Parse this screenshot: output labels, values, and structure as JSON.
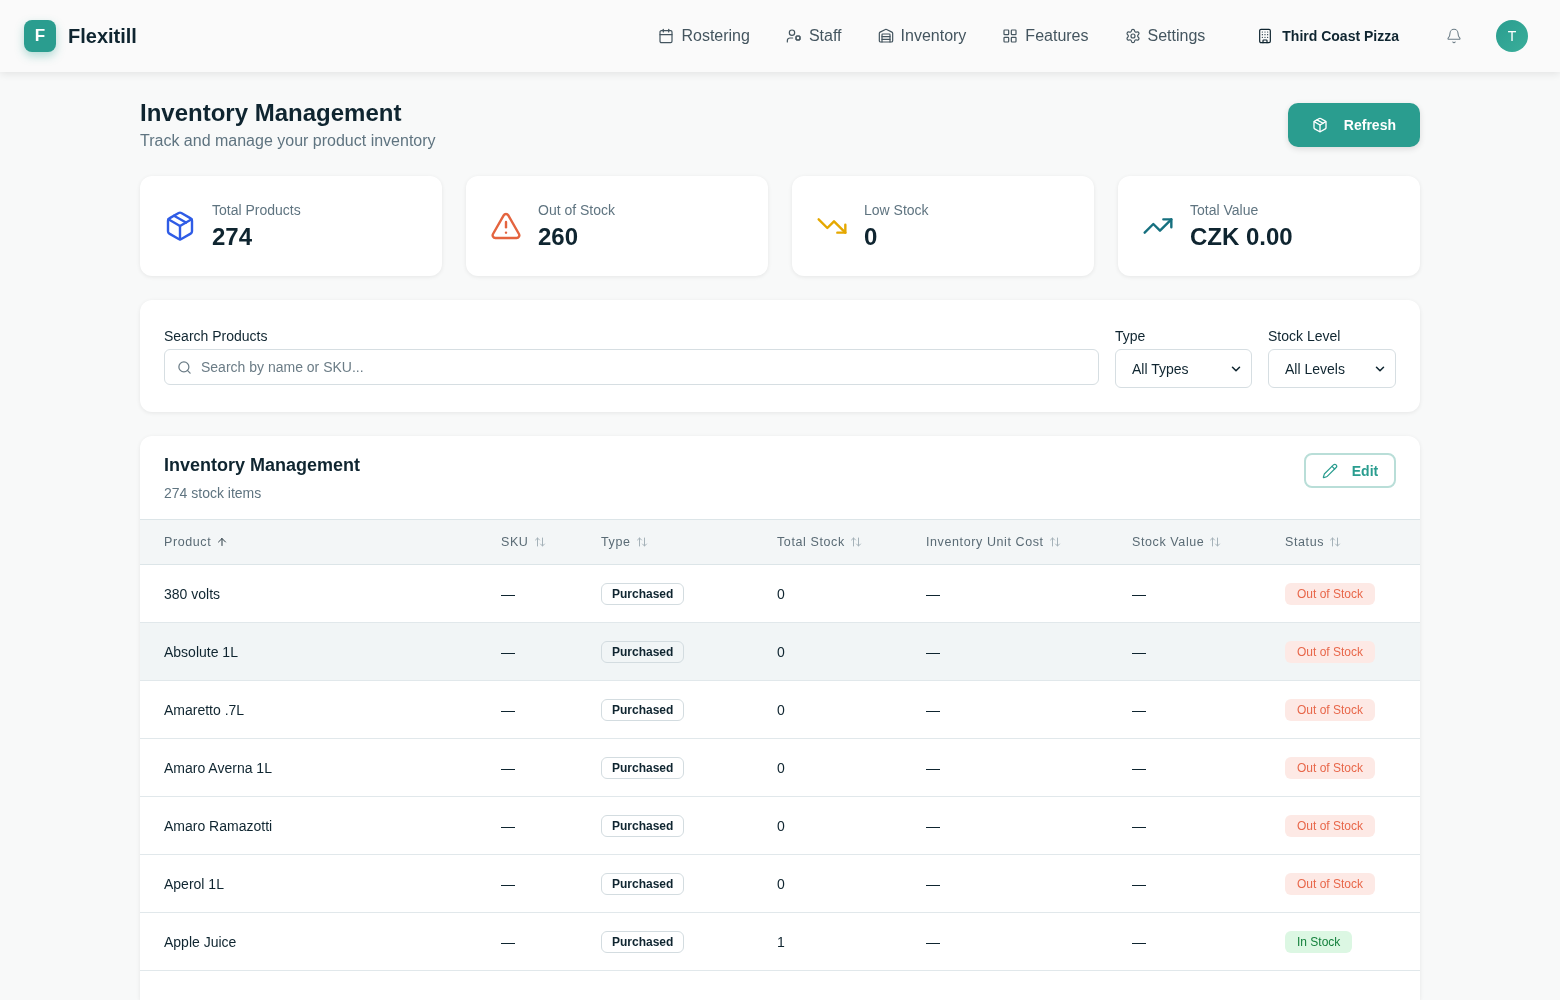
{
  "app": {
    "logo_letter": "F",
    "name": "Flexitill"
  },
  "nav": {
    "items": [
      {
        "label": "Rostering"
      },
      {
        "label": "Staff"
      },
      {
        "label": "Inventory"
      },
      {
        "label": "Features"
      },
      {
        "label": "Settings"
      }
    ]
  },
  "org": {
    "name": "Third Coast Pizza"
  },
  "user": {
    "initial": "T"
  },
  "page": {
    "title": "Inventory Management",
    "subtitle": "Track and manage your product inventory",
    "refresh_label": "Refresh"
  },
  "stats": [
    {
      "label": "Total Products",
      "value": "274"
    },
    {
      "label": "Out of Stock",
      "value": "260"
    },
    {
      "label": "Low Stock",
      "value": "0"
    },
    {
      "label": "Total Value",
      "value": "CZK 0.00"
    }
  ],
  "filters": {
    "search": {
      "label": "Search Products",
      "placeholder": "Search by name or SKU..."
    },
    "type": {
      "label": "Type",
      "value": "All Types"
    },
    "stock_level": {
      "label": "Stock Level",
      "value": "All Levels"
    }
  },
  "table": {
    "title": "Inventory Management",
    "subtitle": "274 stock items",
    "edit_label": "Edit",
    "columns": [
      {
        "label": "Product",
        "sorted": true
      },
      {
        "label": "SKU",
        "sorted": false
      },
      {
        "label": "Type",
        "sorted": false
      },
      {
        "label": "Total Stock",
        "sorted": false
      },
      {
        "label": "Inventory Unit Cost",
        "sorted": false
      },
      {
        "label": "Stock Value",
        "sorted": false
      },
      {
        "label": "Status",
        "sorted": false
      }
    ],
    "rows": [
      {
        "product": "380 volts",
        "sku": "—",
        "type": "Purchased",
        "total_stock": "0",
        "unit_cost": "—",
        "stock_value": "—",
        "status": {
          "label": "Out of Stock",
          "kind": "out_of_stock"
        },
        "selected": false
      },
      {
        "product": "Absolute 1L",
        "sku": "—",
        "type": "Purchased",
        "total_stock": "0",
        "unit_cost": "—",
        "stock_value": "—",
        "status": {
          "label": "Out of Stock",
          "kind": "out_of_stock"
        },
        "selected": true
      },
      {
        "product": "Amaretto .7L",
        "sku": "—",
        "type": "Purchased",
        "total_stock": "0",
        "unit_cost": "—",
        "stock_value": "—",
        "status": {
          "label": "Out of Stock",
          "kind": "out_of_stock"
        },
        "selected": false
      },
      {
        "product": "Amaro Averna 1L",
        "sku": "—",
        "type": "Purchased",
        "total_stock": "0",
        "unit_cost": "—",
        "stock_value": "—",
        "status": {
          "label": "Out of Stock",
          "kind": "out_of_stock"
        },
        "selected": false
      },
      {
        "product": "Amaro Ramazotti",
        "sku": "—",
        "type": "Purchased",
        "total_stock": "0",
        "unit_cost": "—",
        "stock_value": "—",
        "status": {
          "label": "Out of Stock",
          "kind": "out_of_stock"
        },
        "selected": false
      },
      {
        "product": "Aperol 1L",
        "sku": "—",
        "type": "Purchased",
        "total_stock": "0",
        "unit_cost": "—",
        "stock_value": "—",
        "status": {
          "label": "Out of Stock",
          "kind": "out_of_stock"
        },
        "selected": false
      },
      {
        "product": "Apple Juice",
        "sku": "—",
        "type": "Purchased",
        "total_stock": "1",
        "unit_cost": "—",
        "stock_value": "—",
        "status": {
          "label": "In Stock",
          "kind": "in_stock"
        },
        "selected": false
      }
    ]
  }
}
